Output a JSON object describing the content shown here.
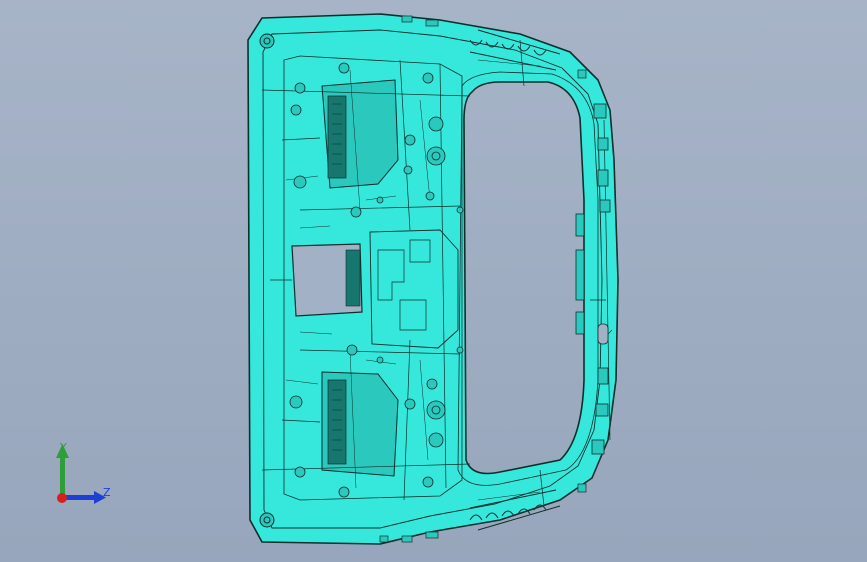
{
  "viewport": {
    "background_top": "#a7b4c8",
    "background_bottom": "#97a6bc",
    "model_color": "#36e8db",
    "edge_color": "#0e2f2d"
  },
  "model": {
    "name": "liftgate-inner-panel"
  },
  "triad": {
    "y_label": "Y",
    "z_label": "Z",
    "y_color": "#2f9d3a",
    "z_color": "#1e3fd6",
    "origin_color": "#d62020"
  }
}
